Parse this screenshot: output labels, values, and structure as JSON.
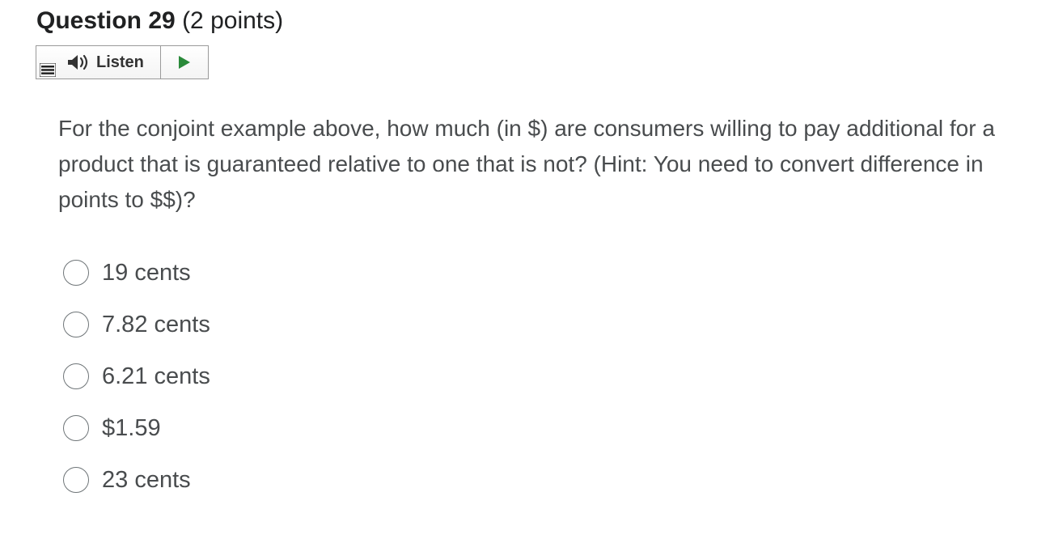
{
  "question": {
    "title": "Question 29",
    "points": "(2 points)",
    "text": "For the conjoint example above, how much (in $) are consumers willing to pay additional for a product that is guaranteed relative to one that is not? (Hint: You need to convert difference in points to $$)?"
  },
  "listen": {
    "label": "Listen",
    "speaker_icon": "speaker-icon",
    "play_icon": "play-icon",
    "menu_icon": "menu-icon",
    "play_color": "#2a8a3a"
  },
  "options": [
    {
      "label": "19 cents",
      "selected": false
    },
    {
      "label": "7.82 cents",
      "selected": false
    },
    {
      "label": "6.21 cents",
      "selected": false
    },
    {
      "label": "$1.59",
      "selected": false
    },
    {
      "label": "23 cents",
      "selected": false
    }
  ]
}
